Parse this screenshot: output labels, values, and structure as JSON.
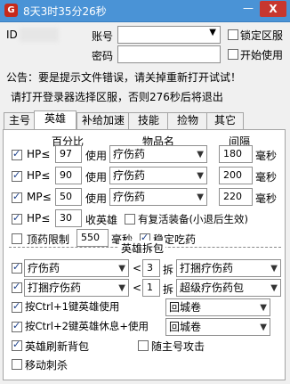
{
  "window": {
    "title": "8天3时35分26秒",
    "minimize": "—",
    "close": "X"
  },
  "login": {
    "id_label": "ID",
    "account_label": "账号",
    "password_label": "密码",
    "lock_server_label": "锁定区服",
    "start_use_label": "开始使用",
    "lock_server_checked": false,
    "start_use_checked": false
  },
  "notices": {
    "announcement": "公告：要是提示文件错误，请关掉重新打开试试！",
    "instruction": "请打开登录器选择区服，否则276秒后将退出"
  },
  "tabs": [
    "主号",
    "英雄",
    "补给加速",
    "技能",
    "捡物",
    "其它"
  ],
  "active_tab": "英雄",
  "potion_table": {
    "headers": {
      "percent": "百分比",
      "item": "物品名",
      "interval": "间隔"
    },
    "rows": [
      {
        "checked": true,
        "stat": "HP≤",
        "value": "97",
        "use": "使用",
        "item": "疗伤药",
        "interval": "180",
        "unit": "毫秒"
      },
      {
        "checked": true,
        "stat": "HP≤",
        "value": "90",
        "use": "使用",
        "item": "疗伤药",
        "interval": "200",
        "unit": "毫秒"
      },
      {
        "checked": true,
        "stat": "MP≤",
        "value": "50",
        "use": "使用",
        "item": "疗伤药",
        "interval": "220",
        "unit": "毫秒"
      }
    ]
  },
  "recall": {
    "checked": true,
    "stat": "HP≤",
    "value": "30",
    "label": "收英雄",
    "revive_checked": false,
    "revive_label": "有复活装备(小退后生效)"
  },
  "limit": {
    "checked": false,
    "label": "顶药限制",
    "value": "550",
    "unit": "毫秒",
    "stable_checked": true,
    "stable_label": "稳定吃药"
  },
  "hero_unpack": {
    "title": "英雄拆包",
    "rows": [
      {
        "checked": true,
        "item": "疗伤药",
        "lt": "<",
        "count": "3",
        "split": "拆",
        "target": "打捆疗伤药"
      },
      {
        "checked": true,
        "item": "打捆疗伤药",
        "lt": "<",
        "count": "1",
        "split": "拆",
        "target": "超级疗伤药包"
      }
    ]
  },
  "hotkeys": [
    {
      "checked": true,
      "label": "按Ctrl+1键英雄使用",
      "item": "回城卷"
    },
    {
      "checked": true,
      "label": "按Ctrl+2键英雄休息+使用",
      "item": "回城卷"
    }
  ],
  "options": {
    "refresh_bag_checked": true,
    "refresh_bag_label": "英雄刷新背包",
    "follow_attack_checked": false,
    "follow_attack_label": "随主号攻击",
    "move_stab_checked": false,
    "move_stab_label": "移动刺杀"
  }
}
